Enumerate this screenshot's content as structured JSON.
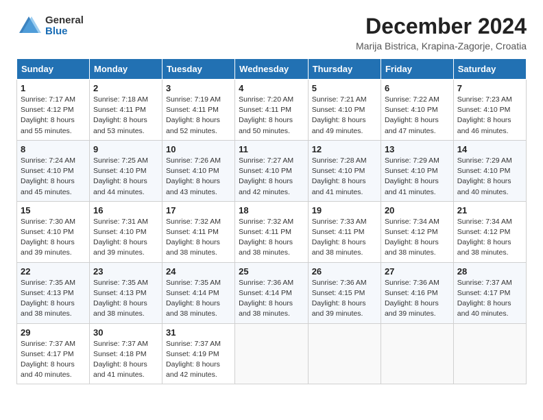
{
  "logo": {
    "general": "General",
    "blue": "Blue"
  },
  "title": {
    "month": "December 2024",
    "location": "Marija Bistrica, Krapina-Zagorje, Croatia"
  },
  "weekdays": [
    "Sunday",
    "Monday",
    "Tuesday",
    "Wednesday",
    "Thursday",
    "Friday",
    "Saturday"
  ],
  "weeks": [
    [
      {
        "day": "1",
        "sunrise": "7:17 AM",
        "sunset": "4:12 PM",
        "daylight": "8 hours and 55 minutes."
      },
      {
        "day": "2",
        "sunrise": "7:18 AM",
        "sunset": "4:11 PM",
        "daylight": "8 hours and 53 minutes."
      },
      {
        "day": "3",
        "sunrise": "7:19 AM",
        "sunset": "4:11 PM",
        "daylight": "8 hours and 52 minutes."
      },
      {
        "day": "4",
        "sunrise": "7:20 AM",
        "sunset": "4:11 PM",
        "daylight": "8 hours and 50 minutes."
      },
      {
        "day": "5",
        "sunrise": "7:21 AM",
        "sunset": "4:10 PM",
        "daylight": "8 hours and 49 minutes."
      },
      {
        "day": "6",
        "sunrise": "7:22 AM",
        "sunset": "4:10 PM",
        "daylight": "8 hours and 47 minutes."
      },
      {
        "day": "7",
        "sunrise": "7:23 AM",
        "sunset": "4:10 PM",
        "daylight": "8 hours and 46 minutes."
      }
    ],
    [
      {
        "day": "8",
        "sunrise": "7:24 AM",
        "sunset": "4:10 PM",
        "daylight": "8 hours and 45 minutes."
      },
      {
        "day": "9",
        "sunrise": "7:25 AM",
        "sunset": "4:10 PM",
        "daylight": "8 hours and 44 minutes."
      },
      {
        "day": "10",
        "sunrise": "7:26 AM",
        "sunset": "4:10 PM",
        "daylight": "8 hours and 43 minutes."
      },
      {
        "day": "11",
        "sunrise": "7:27 AM",
        "sunset": "4:10 PM",
        "daylight": "8 hours and 42 minutes."
      },
      {
        "day": "12",
        "sunrise": "7:28 AM",
        "sunset": "4:10 PM",
        "daylight": "8 hours and 41 minutes."
      },
      {
        "day": "13",
        "sunrise": "7:29 AM",
        "sunset": "4:10 PM",
        "daylight": "8 hours and 41 minutes."
      },
      {
        "day": "14",
        "sunrise": "7:29 AM",
        "sunset": "4:10 PM",
        "daylight": "8 hours and 40 minutes."
      }
    ],
    [
      {
        "day": "15",
        "sunrise": "7:30 AM",
        "sunset": "4:10 PM",
        "daylight": "8 hours and 39 minutes."
      },
      {
        "day": "16",
        "sunrise": "7:31 AM",
        "sunset": "4:10 PM",
        "daylight": "8 hours and 39 minutes."
      },
      {
        "day": "17",
        "sunrise": "7:32 AM",
        "sunset": "4:11 PM",
        "daylight": "8 hours and 38 minutes."
      },
      {
        "day": "18",
        "sunrise": "7:32 AM",
        "sunset": "4:11 PM",
        "daylight": "8 hours and 38 minutes."
      },
      {
        "day": "19",
        "sunrise": "7:33 AM",
        "sunset": "4:11 PM",
        "daylight": "8 hours and 38 minutes."
      },
      {
        "day": "20",
        "sunrise": "7:34 AM",
        "sunset": "4:12 PM",
        "daylight": "8 hours and 38 minutes."
      },
      {
        "day": "21",
        "sunrise": "7:34 AM",
        "sunset": "4:12 PM",
        "daylight": "8 hours and 38 minutes."
      }
    ],
    [
      {
        "day": "22",
        "sunrise": "7:35 AM",
        "sunset": "4:13 PM",
        "daylight": "8 hours and 38 minutes."
      },
      {
        "day": "23",
        "sunrise": "7:35 AM",
        "sunset": "4:13 PM",
        "daylight": "8 hours and 38 minutes."
      },
      {
        "day": "24",
        "sunrise": "7:35 AM",
        "sunset": "4:14 PM",
        "daylight": "8 hours and 38 minutes."
      },
      {
        "day": "25",
        "sunrise": "7:36 AM",
        "sunset": "4:14 PM",
        "daylight": "8 hours and 38 minutes."
      },
      {
        "day": "26",
        "sunrise": "7:36 AM",
        "sunset": "4:15 PM",
        "daylight": "8 hours and 39 minutes."
      },
      {
        "day": "27",
        "sunrise": "7:36 AM",
        "sunset": "4:16 PM",
        "daylight": "8 hours and 39 minutes."
      },
      {
        "day": "28",
        "sunrise": "7:37 AM",
        "sunset": "4:17 PM",
        "daylight": "8 hours and 40 minutes."
      }
    ],
    [
      {
        "day": "29",
        "sunrise": "7:37 AM",
        "sunset": "4:17 PM",
        "daylight": "8 hours and 40 minutes."
      },
      {
        "day": "30",
        "sunrise": "7:37 AM",
        "sunset": "4:18 PM",
        "daylight": "8 hours and 41 minutes."
      },
      {
        "day": "31",
        "sunrise": "7:37 AM",
        "sunset": "4:19 PM",
        "daylight": "8 hours and 42 minutes."
      },
      null,
      null,
      null,
      null
    ]
  ],
  "labels": {
    "sunrise": "Sunrise:",
    "sunset": "Sunset:",
    "daylight": "Daylight:"
  }
}
